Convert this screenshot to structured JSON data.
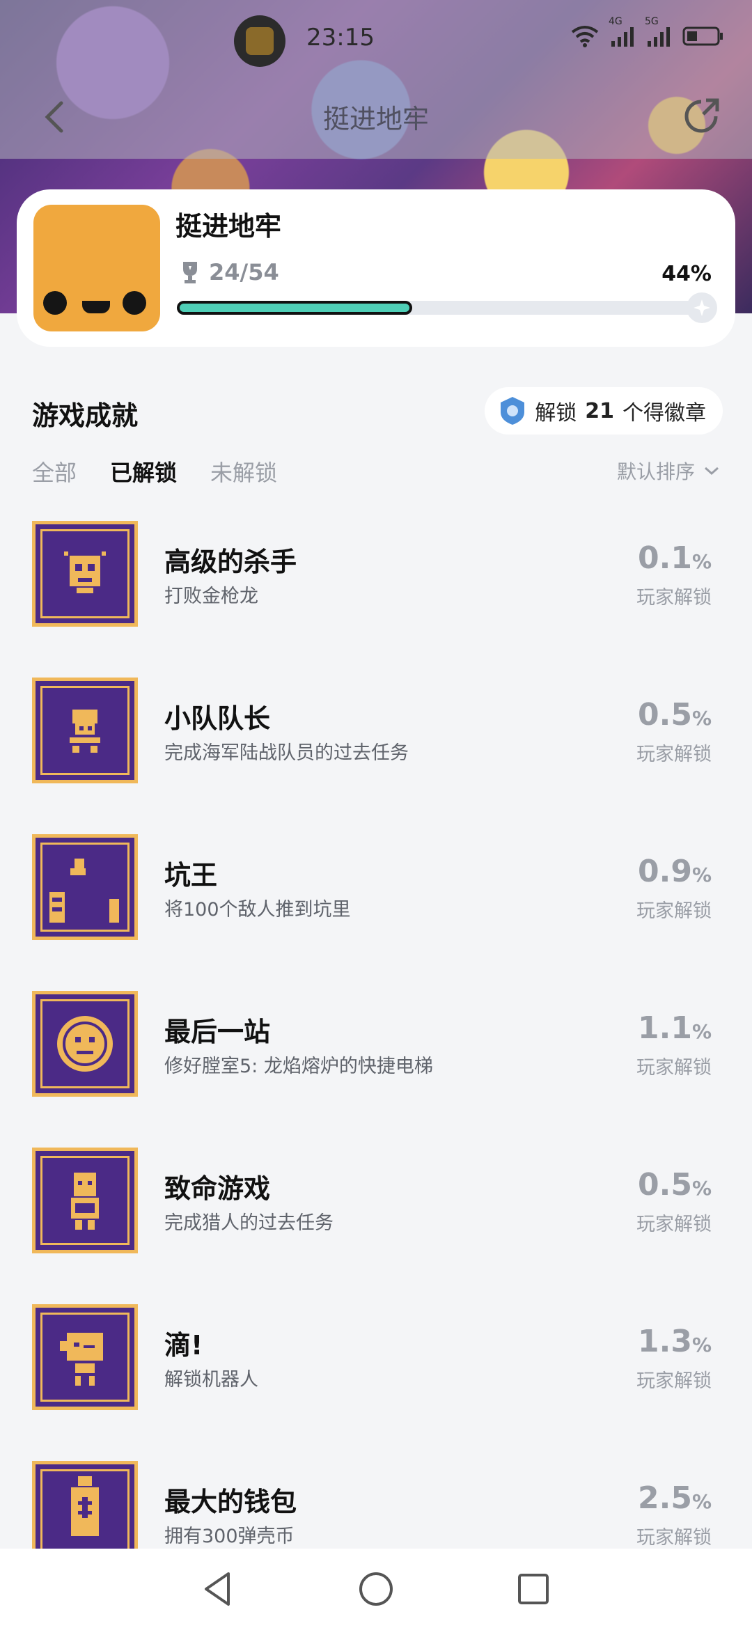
{
  "status_bar": {
    "time": "23:15",
    "net1": "4G",
    "net2": "5G"
  },
  "header": {
    "title": "挺进地牢"
  },
  "game": {
    "name": "挺进地牢",
    "trophies": "24/54",
    "percent": "44%",
    "progress_fraction": 0.44
  },
  "section": {
    "title": "游戏成就",
    "badge_prefix": "解锁",
    "badge_count": "21",
    "badge_suffix": "个得徽章",
    "tabs": [
      "全部",
      "已解锁",
      "未解锁"
    ],
    "active_tab": "已解锁",
    "sort_label": "默认排序"
  },
  "achievements": [
    {
      "name": "高级的杀手",
      "desc": "打败金枪龙",
      "pct": "0.1",
      "unit": "%",
      "label": "玩家解锁"
    },
    {
      "name": "小队队长",
      "desc": "完成海军陆战队员的过去任务",
      "pct": "0.5",
      "unit": "%",
      "label": "玩家解锁"
    },
    {
      "name": "坑王",
      "desc": "将100个敌人推到坑里",
      "pct": "0.9",
      "unit": "%",
      "label": "玩家解锁"
    },
    {
      "name": "最后一站",
      "desc": "修好膛室5: 龙焰熔炉的快捷电梯",
      "pct": "1.1",
      "unit": "%",
      "label": "玩家解锁"
    },
    {
      "name": "致命游戏",
      "desc": "完成猎人的过去任务",
      "pct": "0.5",
      "unit": "%",
      "label": "玩家解锁"
    },
    {
      "name": "滴!",
      "desc": "解锁机器人",
      "pct": "1.3",
      "unit": "%",
      "label": "玩家解锁"
    },
    {
      "name": "最大的钱包",
      "desc": "拥有300弹壳币",
      "pct": "2.5",
      "unit": "%",
      "label": "玩家解锁"
    }
  ],
  "colors": {
    "accent": "#4fcfb7",
    "badge_purple": "#4b2a86",
    "badge_gold": "#f0b85a",
    "game_icon": "#f0a83e"
  }
}
